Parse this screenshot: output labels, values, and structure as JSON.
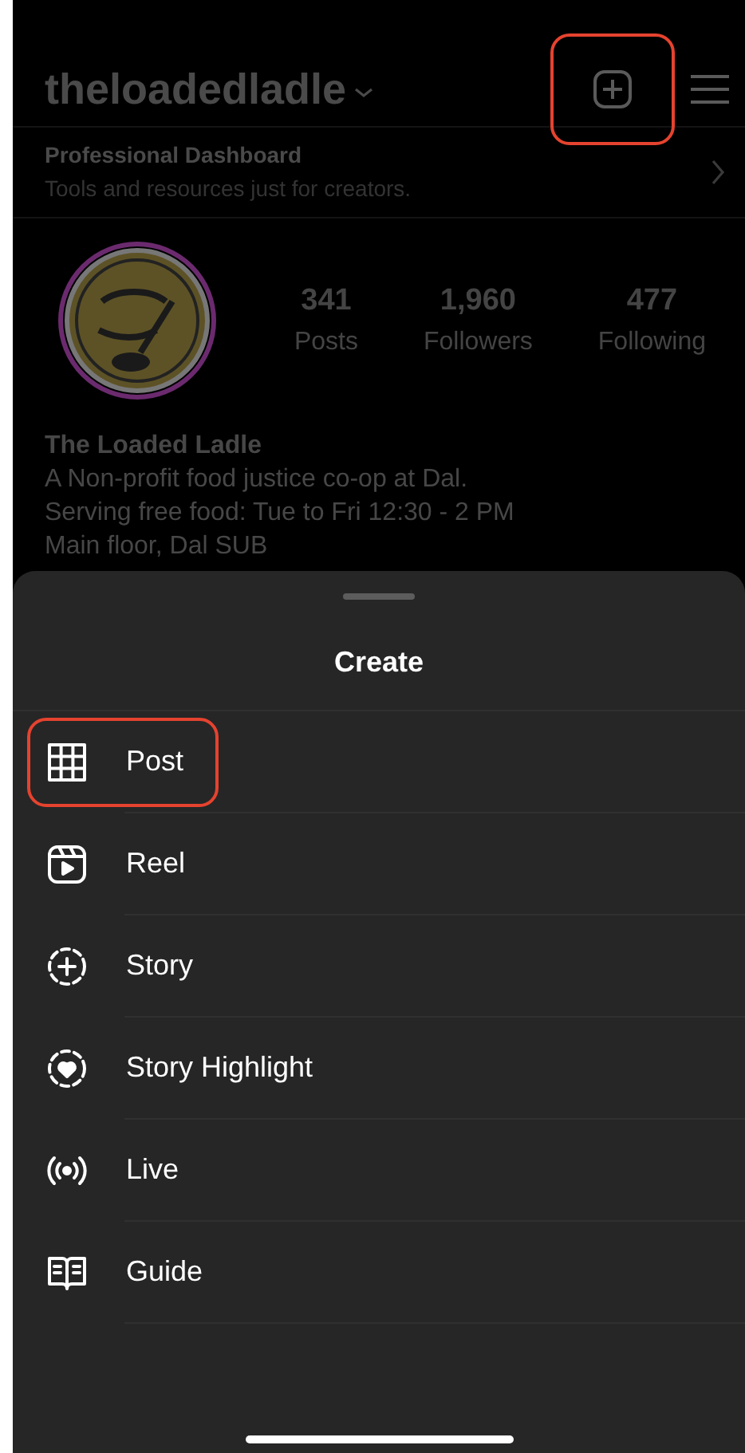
{
  "header": {
    "username": "theloadedladle",
    "add_button": {
      "highlighted": true
    }
  },
  "dashboard": {
    "title": "Professional Dashboard",
    "subtitle": "Tools and resources just for creators."
  },
  "profile": {
    "stats": [
      {
        "value": "341",
        "label": "Posts"
      },
      {
        "value": "1,960",
        "label": "Followers"
      },
      {
        "value": "477",
        "label": "Following"
      }
    ],
    "name": "The Loaded Ladle",
    "bio": [
      "A Non-profit food justice co-op at Dal.",
      "Serving free food: Tue to Fri 12:30 - 2 PM",
      "Main floor, Dal SUB"
    ]
  },
  "sheet": {
    "title": "Create",
    "items": [
      {
        "kind": "post",
        "label": "Post",
        "highlighted": true
      },
      {
        "kind": "reel",
        "label": "Reel",
        "highlighted": false
      },
      {
        "kind": "story",
        "label": "Story",
        "highlighted": false
      },
      {
        "kind": "highlight",
        "label": "Story Highlight",
        "highlighted": false
      },
      {
        "kind": "live",
        "label": "Live",
        "highlighted": false
      },
      {
        "kind": "guide",
        "label": "Guide",
        "highlighted": false
      }
    ]
  }
}
